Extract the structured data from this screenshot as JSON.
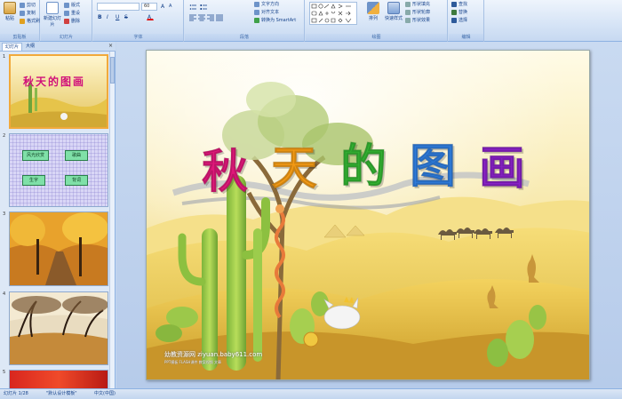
{
  "ribbon": {
    "clipboard": {
      "paste": "粘贴",
      "cut": "剪切",
      "copy": "复制",
      "format_painter": "格式刷",
      "label": "剪贴板"
    },
    "slides": {
      "new_slide": "新建幻灯片",
      "layout": "版式",
      "reset": "重设",
      "delete": "删除",
      "label": "幻灯片"
    },
    "font": {
      "font_value": "",
      "size_value": "60",
      "label": "字体"
    },
    "paragraph": {
      "text_direction": "文字方向",
      "align_text": "对齐文本",
      "smartart": "转换为 SmartArt",
      "label": "段落"
    },
    "drawing": {
      "arrange": "排列",
      "quick_styles": "快速样式",
      "shape_fill": "形状填充",
      "shape_outline": "形状轮廓",
      "shape_effects": "形状效果",
      "label": "绘图"
    },
    "editing": {
      "find": "查找",
      "replace": "替换",
      "select": "选择",
      "label": "编辑"
    }
  },
  "left_panel": {
    "tabs": [
      "幻灯片",
      "大纲"
    ],
    "close": "×",
    "slide_numbers": [
      "1",
      "2",
      "3",
      "4",
      "5"
    ],
    "slide2_buttons": [
      "风光欣赏",
      "歌曲",
      "生字",
      "背词"
    ],
    "slide1_title": "秋天的图画"
  },
  "slide": {
    "title_chars": [
      "秋",
      "天",
      "的",
      "图",
      "画"
    ],
    "title_colors": [
      "#e0187a",
      "#f39a14",
      "#33b432",
      "#2f7ee0",
      "#8a22c8"
    ],
    "watermark": "幼教资源网 ziyuan.baby611.com",
    "watermark_sub": "PPT模板 FLASH课件 教案视频 文章"
  },
  "status_bar": {
    "slide_info": "幻灯片 1/28",
    "theme": "\"默认设计模板\"",
    "language": "中文(中国)"
  }
}
